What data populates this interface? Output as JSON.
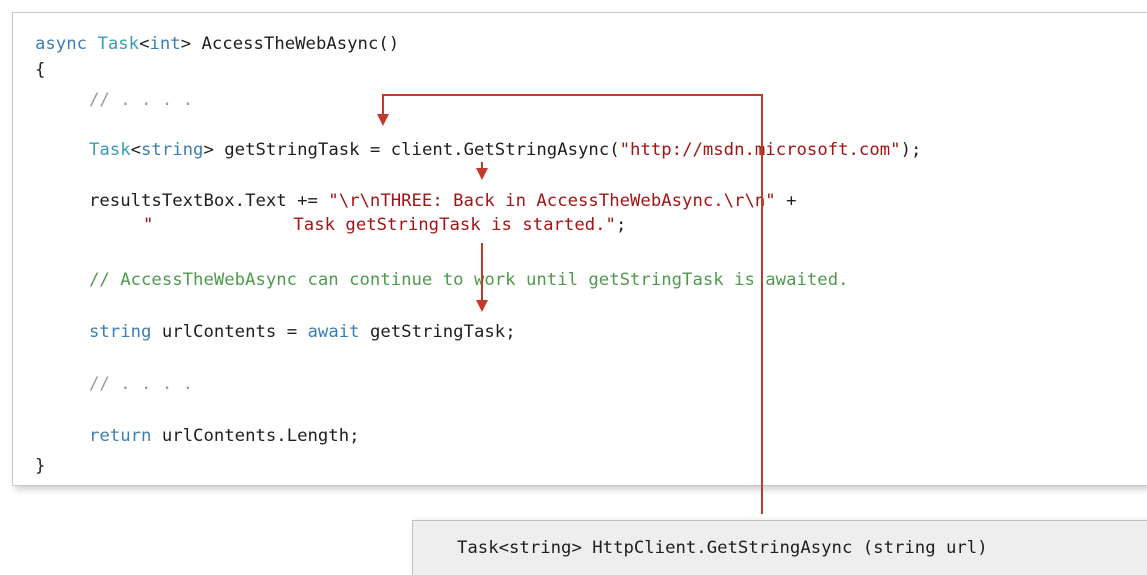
{
  "code": {
    "line1": {
      "kw_async": "async",
      "type_task": "Task",
      "lt": "<",
      "kw_int": "int",
      "rest": "> AccessTheWebAsync()"
    },
    "line2": "{",
    "line3": "// . . . .",
    "line4": {
      "type_task": "Task",
      "lt": "<",
      "kw_string": "string",
      "rest": "> getStringTask = client.GetStringAsync(",
      "str": "\"http://msdn.microsoft.com\"",
      "end": ");"
    },
    "line5": {
      "lhs": "resultsTextBox.Text += ",
      "str": "\"\\r\\nTHREE: Back in AccessTheWebAsync.\\r\\n\"",
      "plus": " +"
    },
    "line6": {
      "str_open": "\"",
      "str_rest": "Task getStringTask is started.\"",
      "end": ";"
    },
    "line7": "// AccessTheWebAsync can continue to work until getStringTask is awaited.",
    "line8": {
      "kw_string": "string",
      "mid": " urlContents = ",
      "kw_await": "await",
      "rest": " getStringTask;"
    },
    "line9": "// . . . .",
    "line10": {
      "kw_return": "return",
      "rest": " urlContents.Length;"
    },
    "line11": "}"
  },
  "signature": "Task<string> HttpClient.GetStringAsync (string url)",
  "colors": {
    "keyword": "#3c7fb4",
    "type": "#3c9ab8",
    "string": "#a31515",
    "comment": "#4e9a4e",
    "comment_dots": "#9a9a9a",
    "arrow": "#c0392b",
    "signature_bg": "#eeeeee"
  }
}
